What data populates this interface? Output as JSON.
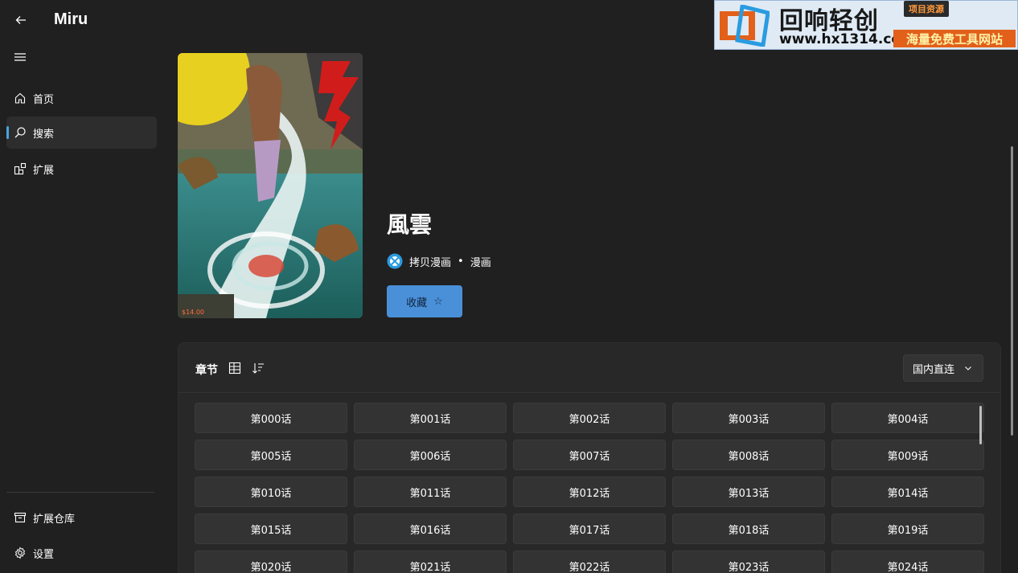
{
  "app": {
    "title": "Miru"
  },
  "sidebar": {
    "items": [
      {
        "label": "首页",
        "icon": "home-icon"
      },
      {
        "label": "搜索",
        "icon": "search-icon",
        "active": true
      },
      {
        "label": "扩展",
        "icon": "extensions-icon"
      }
    ],
    "bottom_items": [
      {
        "label": "扩展仓库",
        "icon": "repository-icon"
      },
      {
        "label": "设置",
        "icon": "gear-icon"
      }
    ]
  },
  "detail": {
    "title": "風雲",
    "source_name": "拷贝漫画",
    "separator": "•",
    "category": "漫画",
    "favorite_label": "收藏",
    "favorite_icon": "☆"
  },
  "chapters": {
    "header": "章节",
    "source_select": "国内直连",
    "items": [
      "第000话",
      "第001话",
      "第002话",
      "第003话",
      "第004话",
      "第005话",
      "第006话",
      "第007话",
      "第008话",
      "第009话",
      "第010话",
      "第011话",
      "第012话",
      "第013话",
      "第014话",
      "第015话",
      "第016话",
      "第017话",
      "第018话",
      "第019话",
      "第020话",
      "第021话",
      "第022话",
      "第023话",
      "第024话"
    ]
  },
  "watermark": {
    "brand": "回响轻创",
    "tag": "项目资源",
    "url": "www.hx1314.cc",
    "slogan": "海量免费工具网站"
  },
  "colors": {
    "background": "#202020",
    "accent": "#4aa3df",
    "favorite_button": "#4a90d9",
    "panel": "#282828"
  }
}
